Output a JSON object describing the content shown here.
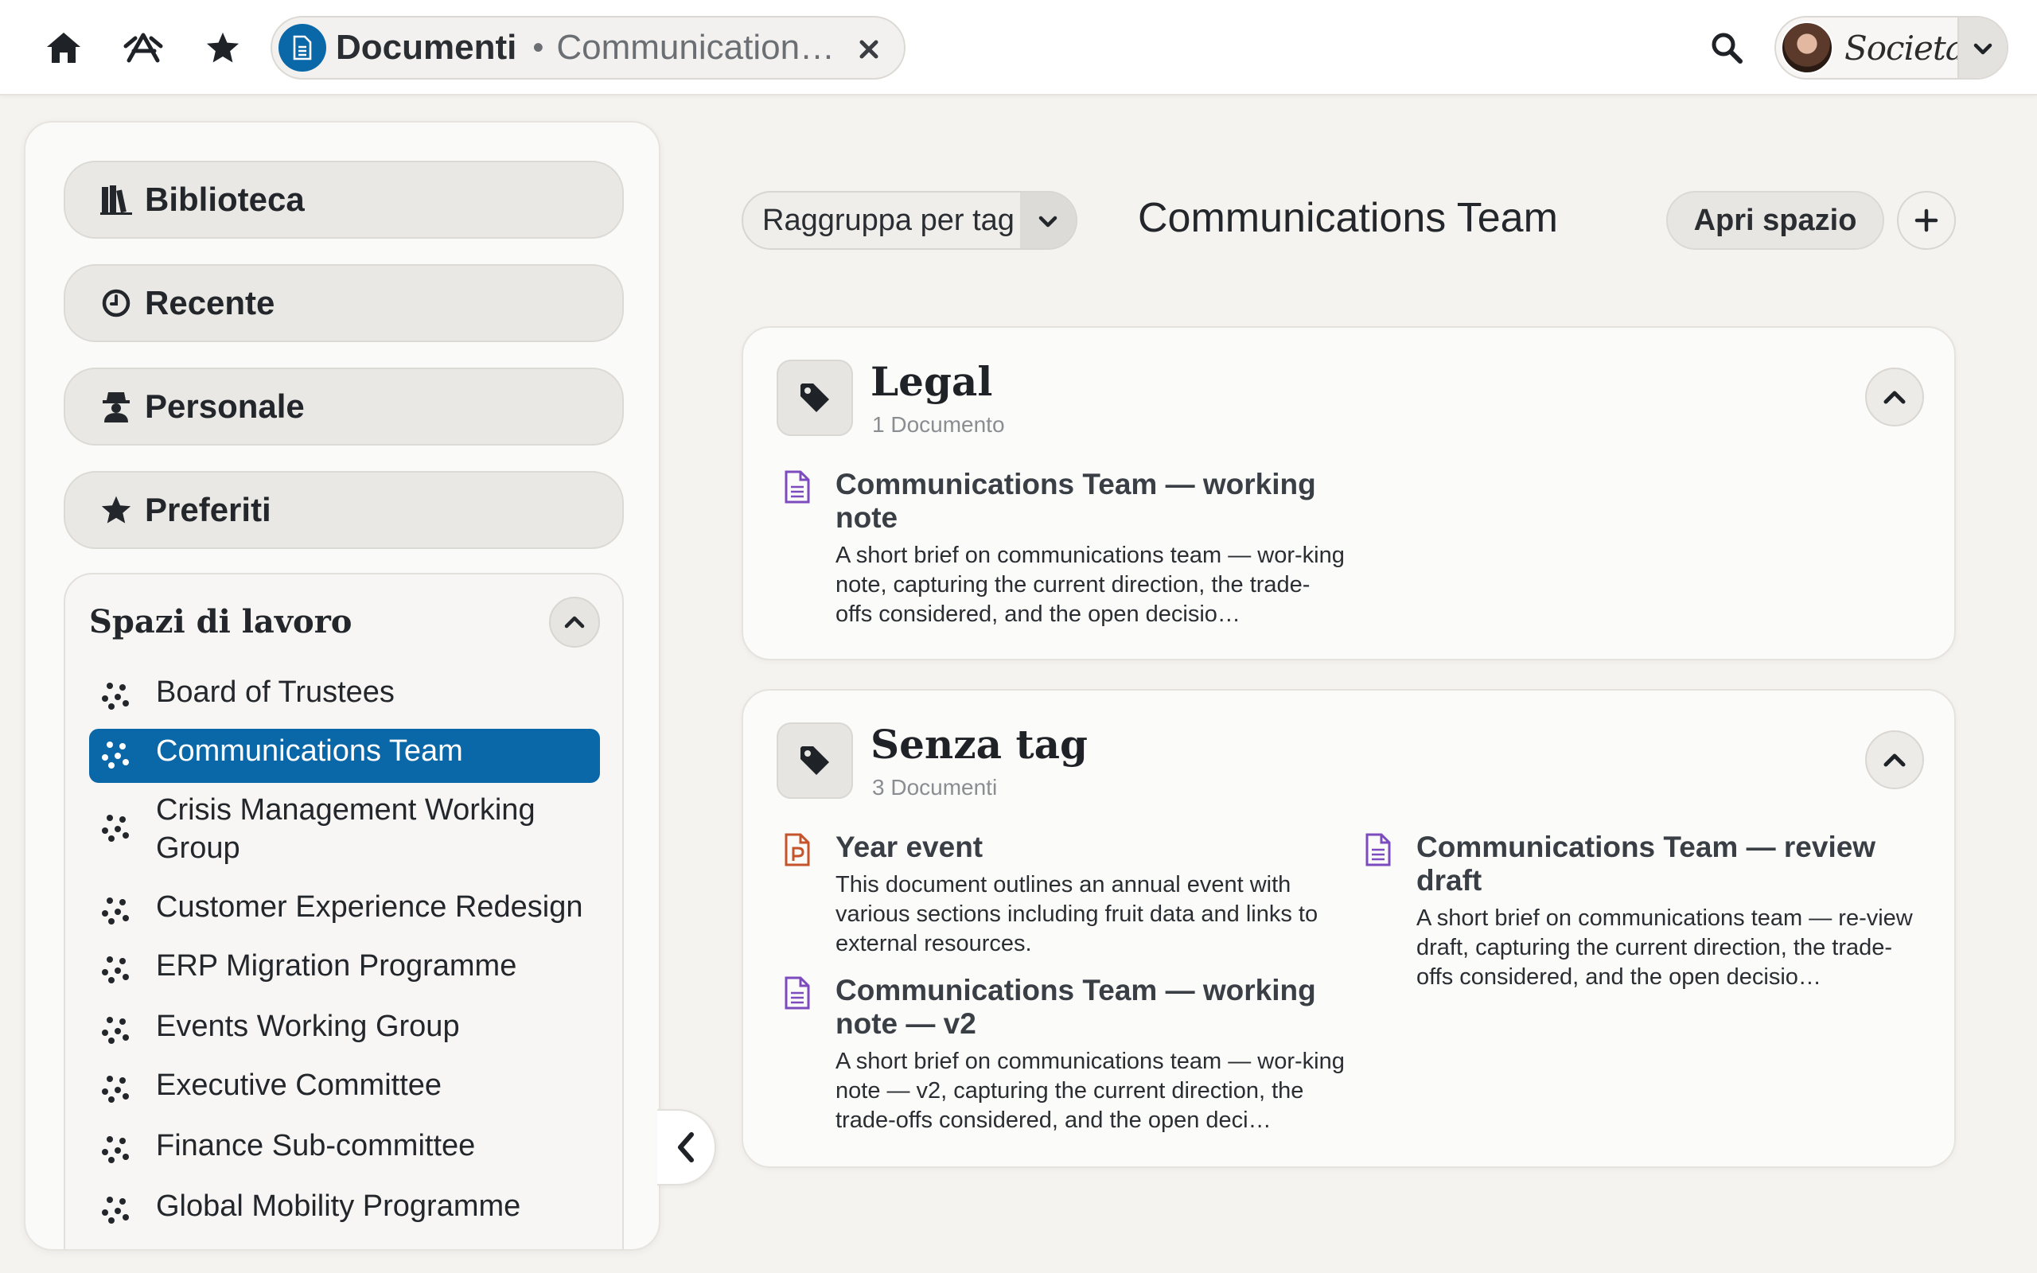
{
  "topbar": {
    "home_icon": "home-icon",
    "apps_icon": "apps-icon",
    "favorites_icon": "star-icon",
    "tab": {
      "title": "Documenti",
      "separator": "•",
      "subtitle": "Communication…",
      "icon": "document-icon"
    },
    "search_icon": "search-icon",
    "brand": "Societas"
  },
  "sidebar": {
    "nav": [
      {
        "label": "Biblioteca",
        "icon": "books-icon"
      },
      {
        "label": "Recente",
        "icon": "clock-icon"
      },
      {
        "label": "Personale",
        "icon": "user-secret-icon"
      },
      {
        "label": "Preferiti",
        "icon": "star-icon"
      }
    ],
    "workspaces": {
      "title": "Spazi di lavoro",
      "items": [
        {
          "label": "Board of Trustees"
        },
        {
          "label": "Communications Team",
          "active": true
        },
        {
          "label": "Crisis Management Working Group"
        },
        {
          "label": "Customer Experience Redesign"
        },
        {
          "label": "ERP Migration Programme"
        },
        {
          "label": "Events Working Group"
        },
        {
          "label": "Executive Committee"
        },
        {
          "label": "Finance Sub-committee"
        },
        {
          "label": "Global Mobility Programme"
        }
      ]
    }
  },
  "main": {
    "group_by": "Raggruppa per tag",
    "title": "Communications Team",
    "open_space": "Apri spazio",
    "groups": [
      {
        "name": "Legal",
        "count": "1 Documento",
        "docs": [
          {
            "title": "Communications Team — working note",
            "desc": "A short brief on communications team — wor-king note, capturing the current direction, the trade-offs considered, and the open decisio…",
            "type": "document"
          }
        ]
      },
      {
        "name": "Senza tag",
        "count": "3 Documenti",
        "docs": [
          {
            "title": "Year event",
            "desc": "This document outlines an annual event with various sections including fruit data and links to external resources.",
            "type": "presentation"
          },
          {
            "title": "Communications Team — review draft",
            "desc": "A short brief on communications team — re-view draft, capturing the current direction, the trade-offs considered, and the open decisio…",
            "type": "document"
          },
          {
            "title": "Communications Team — working note — v2",
            "desc": "A short brief on communications team — wor-king note — v2, capturing the current direction, the trade-offs considered, and the open deci…",
            "type": "document"
          }
        ]
      }
    ]
  },
  "colors": {
    "accent": "#0a67a8",
    "doc_icon": "#7c4bbd",
    "presentation_icon": "#c5542a"
  }
}
